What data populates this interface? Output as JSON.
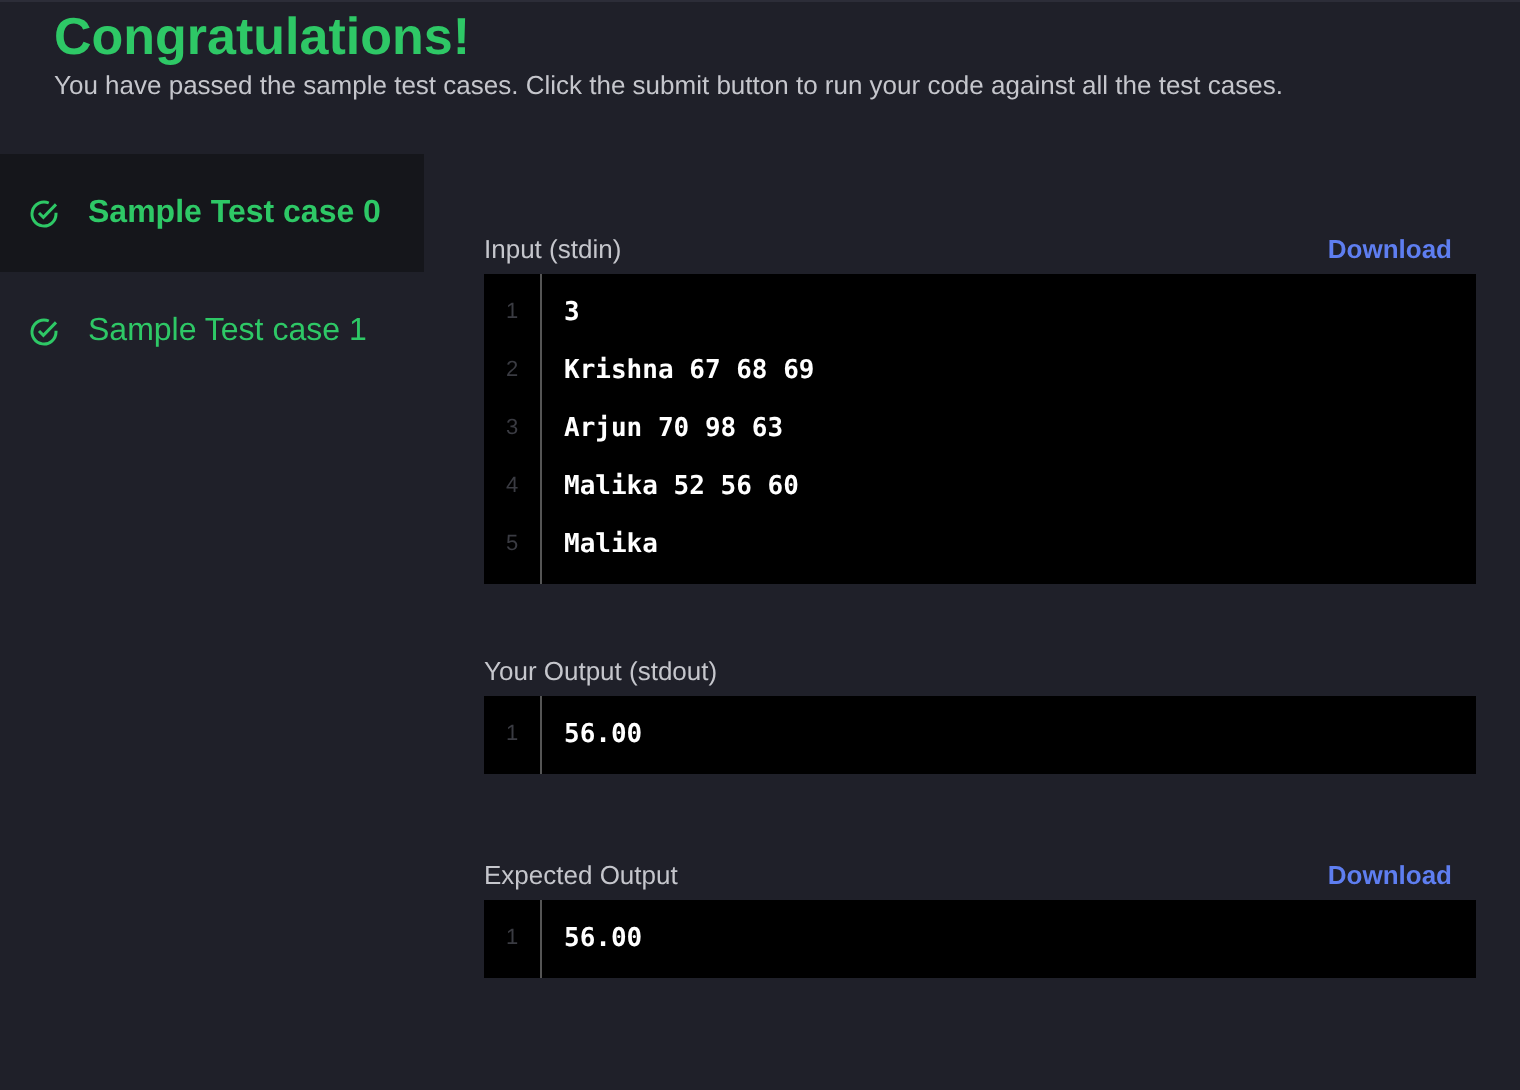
{
  "header": {
    "title": "Congratulations!",
    "message": "You have passed the sample test cases. Click the submit button to run your code against all the test cases."
  },
  "test_cases": [
    {
      "label": "Sample Test case 0",
      "selected": true
    },
    {
      "label": "Sample Test case 1",
      "selected": false
    }
  ],
  "sections": [
    {
      "label": "Input (stdin)",
      "download": "Download",
      "lines": [
        {
          "number": "1",
          "text": "3"
        },
        {
          "number": "2",
          "text": "Krishna 67 68 69"
        },
        {
          "number": "3",
          "text": "Arjun 70 98 63"
        },
        {
          "number": "4",
          "text": "Malika 52 56 60"
        },
        {
          "number": "5",
          "text": "Malika"
        }
      ]
    },
    {
      "label": "Your Output (stdout)",
      "lines": [
        {
          "number": "1",
          "text": "56.00"
        }
      ]
    },
    {
      "label": "Expected Output",
      "download": "Download",
      "lines": [
        {
          "number": "1",
          "text": "56.00"
        }
      ]
    }
  ]
}
